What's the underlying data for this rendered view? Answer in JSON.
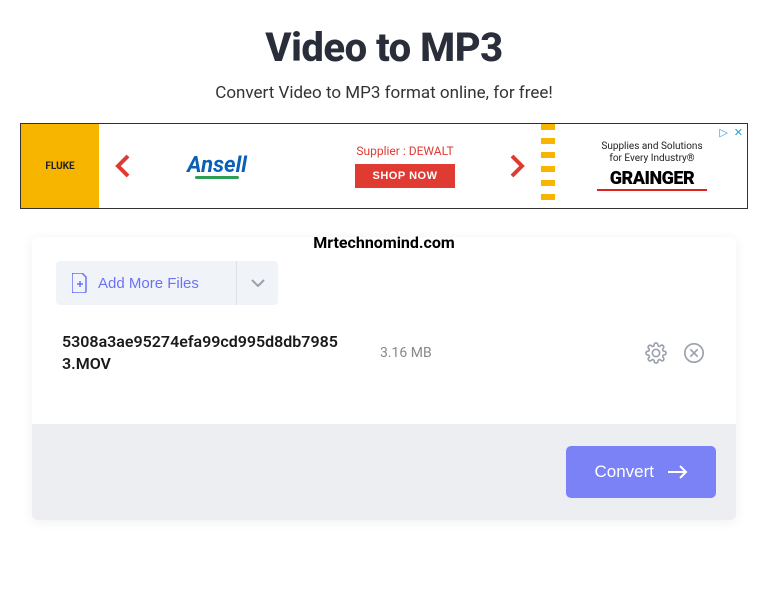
{
  "header": {
    "title": "Video to MP3",
    "subtitle": "Convert Video to MP3 format online, for free!"
  },
  "ad": {
    "fluke": "FLUKE",
    "ansell": "Ansell",
    "supplier_text": "Supplier : DEWALT",
    "shop_now": "SHOP NOW",
    "supplies_line1": "Supplies and Solutions",
    "supplies_line2": "for Every Industry®",
    "grainger": "GRAINGER",
    "ad_info": "▷",
    "ad_close": "✕"
  },
  "watermark": "Mrtechnomind.com",
  "toolbar": {
    "add_more_files": "Add More Files"
  },
  "files": [
    {
      "name": "5308a3ae95274efa99cd995d8db79853.MOV",
      "size": "3.16 MB"
    }
  ],
  "actions": {
    "convert": "Convert"
  }
}
